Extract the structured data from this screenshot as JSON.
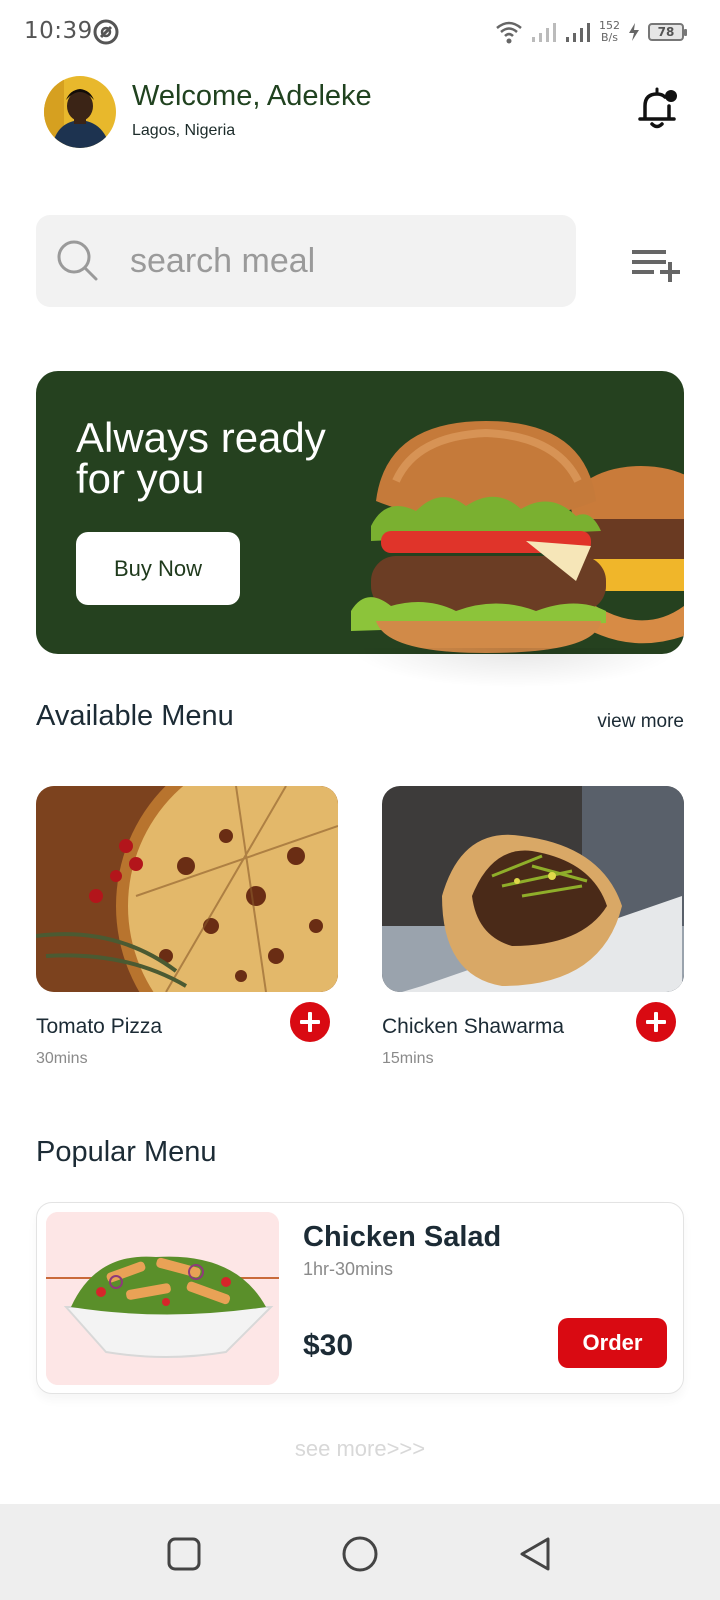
{
  "status_bar": {
    "time": "10:39",
    "net_speed_value": "152",
    "net_speed_unit": "B/s",
    "battery": "78"
  },
  "header": {
    "welcome": "Welcome, Adeleke",
    "location": "Lagos, Nigeria"
  },
  "search": {
    "placeholder": "search meal"
  },
  "banner": {
    "title": "Always ready for you",
    "button": "Buy Now"
  },
  "available": {
    "title": "Available Menu",
    "view_more": "view more",
    "items": [
      {
        "name": "Tomato Pizza",
        "time": "30mins"
      },
      {
        "name": "Chicken Shawarma",
        "time": "15mins"
      }
    ]
  },
  "popular": {
    "title": "Popular Menu",
    "item": {
      "name": "Chicken Salad",
      "time": "1hr-30mins",
      "price": "$30",
      "button": "Order"
    },
    "see_more": "see more>>>"
  },
  "colors": {
    "brand_green": "#25411f",
    "accent_red": "#d90a12"
  },
  "icons": [
    "app-status-icon",
    "wifi-icon",
    "signal-icon",
    "battery-icon",
    "bell-icon",
    "search-icon",
    "filter-add-icon",
    "plus-icon",
    "square-nav-icon",
    "circle-nav-icon",
    "back-triangle-icon"
  ]
}
